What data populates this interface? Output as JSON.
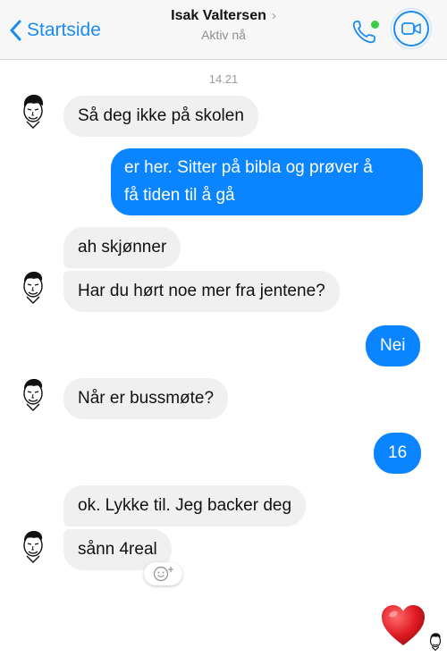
{
  "header": {
    "back_label": "Startside",
    "contact_name": "Isak Valtersen",
    "chevron": "›",
    "status": "Aktiv nå",
    "icons": [
      "chevron-left-icon",
      "phone-icon",
      "video-camera-icon"
    ],
    "online_color": "#3ccb4a"
  },
  "colors": {
    "accent": "#1a8cf0",
    "outgoing_bubble": "#0a84ff",
    "incoming_bubble": "#f0f0f0"
  },
  "chat": {
    "timestamp": "14.21",
    "messages": [
      {
        "direction": "incoming",
        "text": "Så deg ikke på skolen"
      },
      {
        "direction": "outgoing",
        "text_line1": "er her. Sitter på bibla og prøver å",
        "text_line2": "få tiden til å gå"
      },
      {
        "direction": "incoming",
        "text": "ah skjønner"
      },
      {
        "direction": "incoming",
        "text": "Har du hørt noe mer fra jentene?"
      },
      {
        "direction": "outgoing",
        "text": "Nei"
      },
      {
        "direction": "incoming",
        "text": "Når er bussmøte?"
      },
      {
        "direction": "outgoing",
        "text": "16"
      },
      {
        "direction": "incoming",
        "text": "ok. Lykke til. Jeg backer deg"
      },
      {
        "direction": "incoming",
        "text": "sånn 4real"
      }
    ],
    "reaction_icon": "add-reaction-icon",
    "last_sent": "heart-emoji"
  }
}
